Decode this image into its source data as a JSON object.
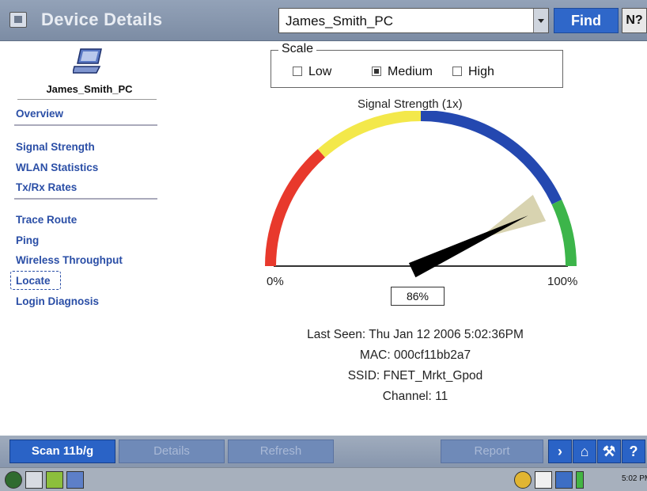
{
  "titlebar": {
    "title": "Device Details",
    "device_select_value": "James_Smith_PC",
    "find_label": "Find",
    "help_label": "N?"
  },
  "sidebar": {
    "device_name": "James_Smith_PC",
    "groups": [
      [
        "Overview"
      ],
      [
        "Signal Strength",
        "WLAN Statistics",
        "Tx/Rx Rates"
      ],
      [
        "Trace Route",
        "Ping",
        "Wireless Throughput",
        "Locate",
        "Login Diagnosis"
      ]
    ],
    "selected": "Locate"
  },
  "scale": {
    "legend": "Scale",
    "options": [
      "Low",
      "Medium",
      "High"
    ],
    "selected": "Medium"
  },
  "gauge": {
    "title": "Signal Strength (1x)",
    "min_label": "0%",
    "max_label": "100%",
    "value_label": "86%",
    "value": 86,
    "colors": {
      "red": "#e8392c",
      "yellow": "#f3e84a",
      "blue": "#2448b0",
      "green": "#3cb54a"
    }
  },
  "info": {
    "last_seen": "Last Seen: Thu Jan 12 2006  5:02:36PM",
    "mac": "MAC: 000cf11bb2a7",
    "ssid": "SSID: FNET_Mrkt_Gpod",
    "channel": "Channel: 11"
  },
  "bottom": {
    "buttons": [
      "Scan 11b/g",
      "Details",
      "Refresh",
      "Report"
    ],
    "icon_buttons": [
      "back-icon",
      "home-icon",
      "tools-icon",
      "help-icon"
    ]
  },
  "taskbar": {
    "time": "5:02 PM"
  }
}
